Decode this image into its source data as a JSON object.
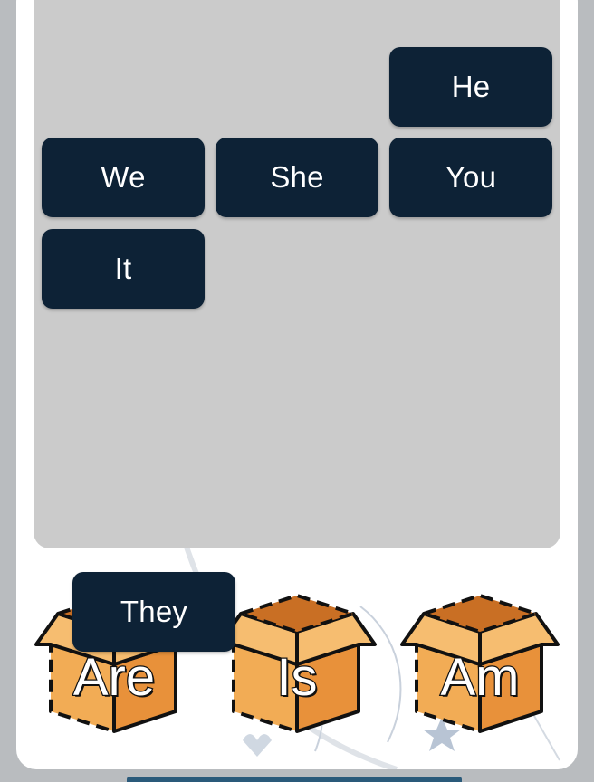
{
  "word_tiles": [
    {
      "text": "He"
    },
    {
      "text": "We"
    },
    {
      "text": "She"
    },
    {
      "text": "You"
    },
    {
      "text": "It"
    },
    {
      "text": "They"
    }
  ],
  "boxes": [
    {
      "label": "Are"
    },
    {
      "label": "Is"
    },
    {
      "label": "Am"
    }
  ],
  "colors": {
    "tile_bg": "#0d2236",
    "drop_area": "#cbcbcb",
    "box_fill": "#f0a94f",
    "box_side": "#e8913a"
  }
}
